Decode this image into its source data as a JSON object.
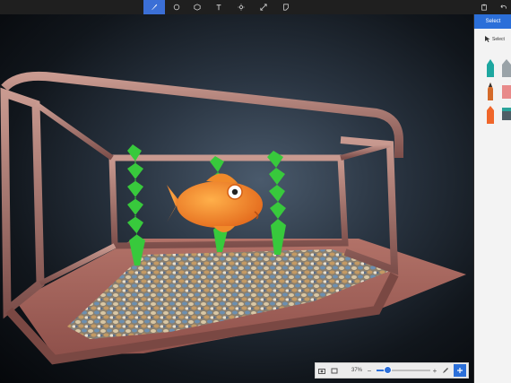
{
  "toolbar": {
    "tools": [
      {
        "name": "brushes",
        "icon": "brush-icon",
        "active": true
      },
      {
        "name": "2d-shapes",
        "icon": "circle-icon",
        "active": false
      },
      {
        "name": "3d-shapes",
        "icon": "cube-icon",
        "active": false
      },
      {
        "name": "text",
        "icon": "text-icon",
        "active": false
      },
      {
        "name": "effects",
        "icon": "sun-icon",
        "active": false
      },
      {
        "name": "canvas",
        "icon": "resize-icon",
        "active": false
      },
      {
        "name": "stickers",
        "icon": "sticker-icon",
        "active": false
      }
    ],
    "right_icons": [
      "paste-icon",
      "undo-icon"
    ]
  },
  "panel": {
    "header": "Select",
    "select_label": "Select"
  },
  "zoom": {
    "percent_text": "37%",
    "level": 0.2
  },
  "colors": {
    "accent": "#2b6fd9",
    "toolbar_bg": "#1f1f1f",
    "seaweed": "#38c93c",
    "fish": "#f07a1c",
    "tank_frame": "#b07a74"
  }
}
